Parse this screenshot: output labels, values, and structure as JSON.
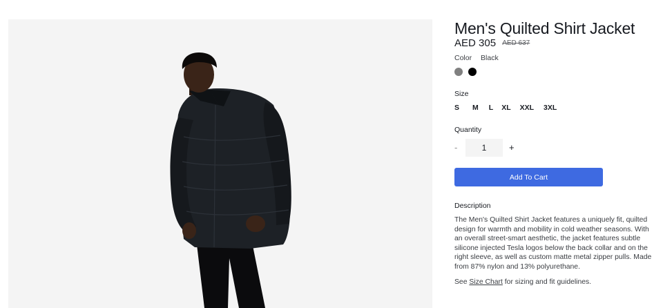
{
  "product": {
    "title": "Men's Quilted Shirt Jacket",
    "price": "AED 305",
    "original_price": "AED 637",
    "image_alt": "model wearing black quilted shirt jacket"
  },
  "color": {
    "label": "Color",
    "selected": "Black",
    "swatches": [
      {
        "name": "Grey",
        "hex": "#808080"
      },
      {
        "name": "Black",
        "hex": "#000000"
      }
    ]
  },
  "size": {
    "label": "Size",
    "options": [
      "S",
      "M",
      "L",
      "XL",
      "XXL",
      "3XL"
    ]
  },
  "quantity": {
    "label": "Quantity",
    "minus": "-",
    "value": "1",
    "plus": "+"
  },
  "cart": {
    "button_label": "Add To Cart",
    "button_color": "#3e6ae1"
  },
  "description": {
    "label": "Description",
    "text": "The Men's Quilted Shirt Jacket features a uniquely fit, quilted design for warmth and mobility in cold weather seasons. With an overall street-smart aesthetic, the jacket features subtle silicone injected Tesla logos below the back collar and on the right sleeve, as well as custom matte metal zipper pulls. Made from 87% nylon and 13% polyurethane.",
    "see_prefix": "See",
    "size_chart_link": "Size Chart",
    "see_suffix": "for sizing and fit guidelines."
  }
}
